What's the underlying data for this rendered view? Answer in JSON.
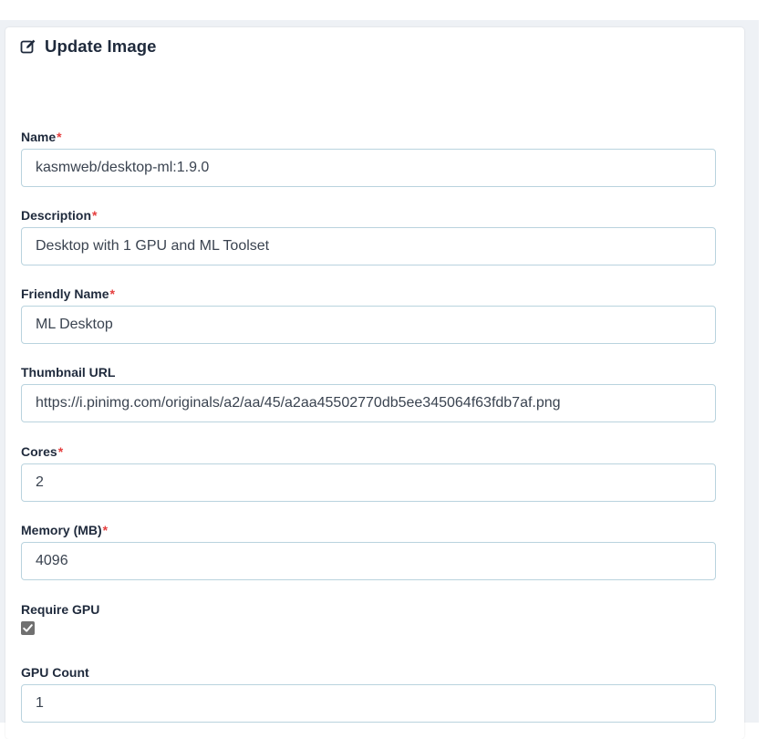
{
  "header": {
    "icon": "edit-icon",
    "title": "Update Image"
  },
  "form": {
    "name": {
      "label": "Name",
      "required": "*",
      "value": "kasmweb/desktop-ml:1.9.0"
    },
    "description": {
      "label": "Description",
      "required": "*",
      "value": "Desktop with 1 GPU and ML Toolset"
    },
    "friendly_name": {
      "label": "Friendly Name",
      "required": "*",
      "value": "ML Desktop"
    },
    "thumbnail_url": {
      "label": "Thumbnail URL",
      "value": "https://i.pinimg.com/originals/a2/aa/45/a2aa45502770db5ee345064f63fdb7af.png"
    },
    "cores": {
      "label": "Cores",
      "required": "*",
      "value": "2"
    },
    "memory": {
      "label": "Memory (MB)",
      "required": "*",
      "value": "4096"
    },
    "require_gpu": {
      "label": "Require GPU",
      "checked": true
    },
    "gpu_count": {
      "label": "GPU Count",
      "value": "1"
    }
  },
  "colors": {
    "required_marker": "#e53e3e",
    "input_border": "#b9d3de",
    "checkbox_fill": "#707070",
    "page_background": "#eef1f5"
  }
}
